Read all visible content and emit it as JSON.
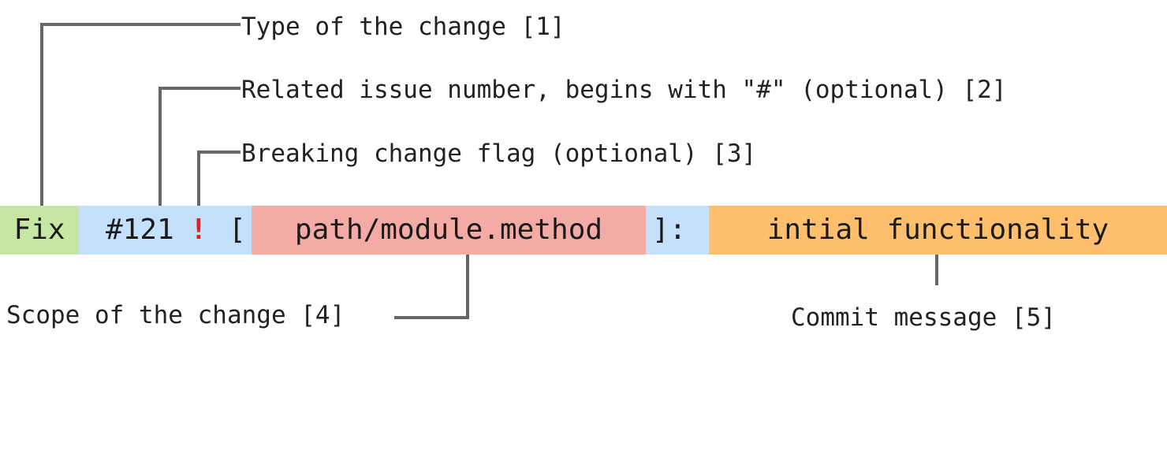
{
  "colors": {
    "type": "#c7e6a4",
    "issue_and_brackets": "#c4e0fa",
    "scope": "#f4aaa5",
    "message": "#ffbf6d",
    "flag": "#e0201b",
    "connector": "#666666"
  },
  "commit": {
    "type": "Fix",
    "issue": "#121",
    "flag": "!",
    "open_bracket": "[",
    "scope": "path/module.method",
    "close_bracket": "]:",
    "message": "intial functionality"
  },
  "annotations": {
    "type": "Type of the change [1]",
    "issue": "Related issue number, begins with \"#\" (optional) [2]",
    "flag": "Breaking change flag (optional) [3]",
    "scope": "Scope of the change [4]",
    "message": "Commit message [5]"
  }
}
